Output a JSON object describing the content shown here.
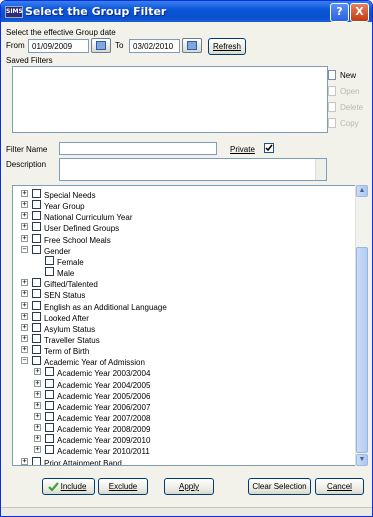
{
  "window": {
    "title": "Select the Group Filter",
    "app_icon_text": "SIMS",
    "help_label": "?",
    "close_label": "X"
  },
  "date": {
    "prompt": "Select the effective Group date",
    "from_label": "From",
    "from_value": "01/09/2009",
    "to_label": "To",
    "to_value": "03/02/2010",
    "refresh_label": "Refresh"
  },
  "saved_filters": {
    "label": "Saved Filters",
    "actions": [
      {
        "label": "New",
        "enabled": true
      },
      {
        "label": "Open",
        "enabled": false
      },
      {
        "label": "Delete",
        "enabled": false
      },
      {
        "label": "Copy",
        "enabled": false
      }
    ]
  },
  "filter": {
    "name_label": "Filter Name",
    "name_value": "",
    "private_label": "Private",
    "private_checked": true,
    "description_label": "Description",
    "description_value": ""
  },
  "tree": [
    {
      "label": "Special Needs",
      "level": 0,
      "expander": "+"
    },
    {
      "label": "Year Group",
      "level": 0,
      "expander": "+"
    },
    {
      "label": "National Curriculum Year",
      "level": 0,
      "expander": "+"
    },
    {
      "label": "User Defined Groups",
      "level": 0,
      "expander": "+"
    },
    {
      "label": "Free School Meals",
      "level": 0,
      "expander": "+"
    },
    {
      "label": "Gender",
      "level": 0,
      "expander": "-"
    },
    {
      "label": "Female",
      "level": 1,
      "expander": ""
    },
    {
      "label": "Male",
      "level": 1,
      "expander": ""
    },
    {
      "label": "Gifted/Talented",
      "level": 0,
      "expander": "+"
    },
    {
      "label": "SEN Status",
      "level": 0,
      "expander": "+"
    },
    {
      "label": "English as an Additional Language",
      "level": 0,
      "expander": "+"
    },
    {
      "label": "Looked After",
      "level": 0,
      "expander": "+"
    },
    {
      "label": "Asylum Status",
      "level": 0,
      "expander": "+"
    },
    {
      "label": "Traveller Status",
      "level": 0,
      "expander": "+"
    },
    {
      "label": "Term of Birth",
      "level": 0,
      "expander": "+"
    },
    {
      "label": "Academic Year of Admission",
      "level": 0,
      "expander": "-"
    },
    {
      "label": "Academic Year 2003/2004",
      "level": 1,
      "expander": "+"
    },
    {
      "label": "Academic Year 2004/2005",
      "level": 1,
      "expander": "+"
    },
    {
      "label": "Academic Year 2005/2006",
      "level": 1,
      "expander": "+"
    },
    {
      "label": "Academic Year 2006/2007",
      "level": 1,
      "expander": "+"
    },
    {
      "label": "Academic Year 2007/2008",
      "level": 1,
      "expander": "+"
    },
    {
      "label": "Academic Year 2008/2009",
      "level": 1,
      "expander": "+"
    },
    {
      "label": "Academic Year 2009/2010",
      "level": 1,
      "expander": "+"
    },
    {
      "label": "Academic Year 2010/2011",
      "level": 1,
      "expander": "+"
    },
    {
      "label": "Prior Attainment Band",
      "level": 0,
      "expander": "+"
    }
  ],
  "buttons": {
    "include": "Include",
    "exclude": "Exclude",
    "apply": "Apply",
    "clear_selection": "Clear Selection",
    "cancel": "Cancel"
  },
  "colors": {
    "titlebar": "#0b57d8",
    "accent_green": "#3aa63a"
  }
}
